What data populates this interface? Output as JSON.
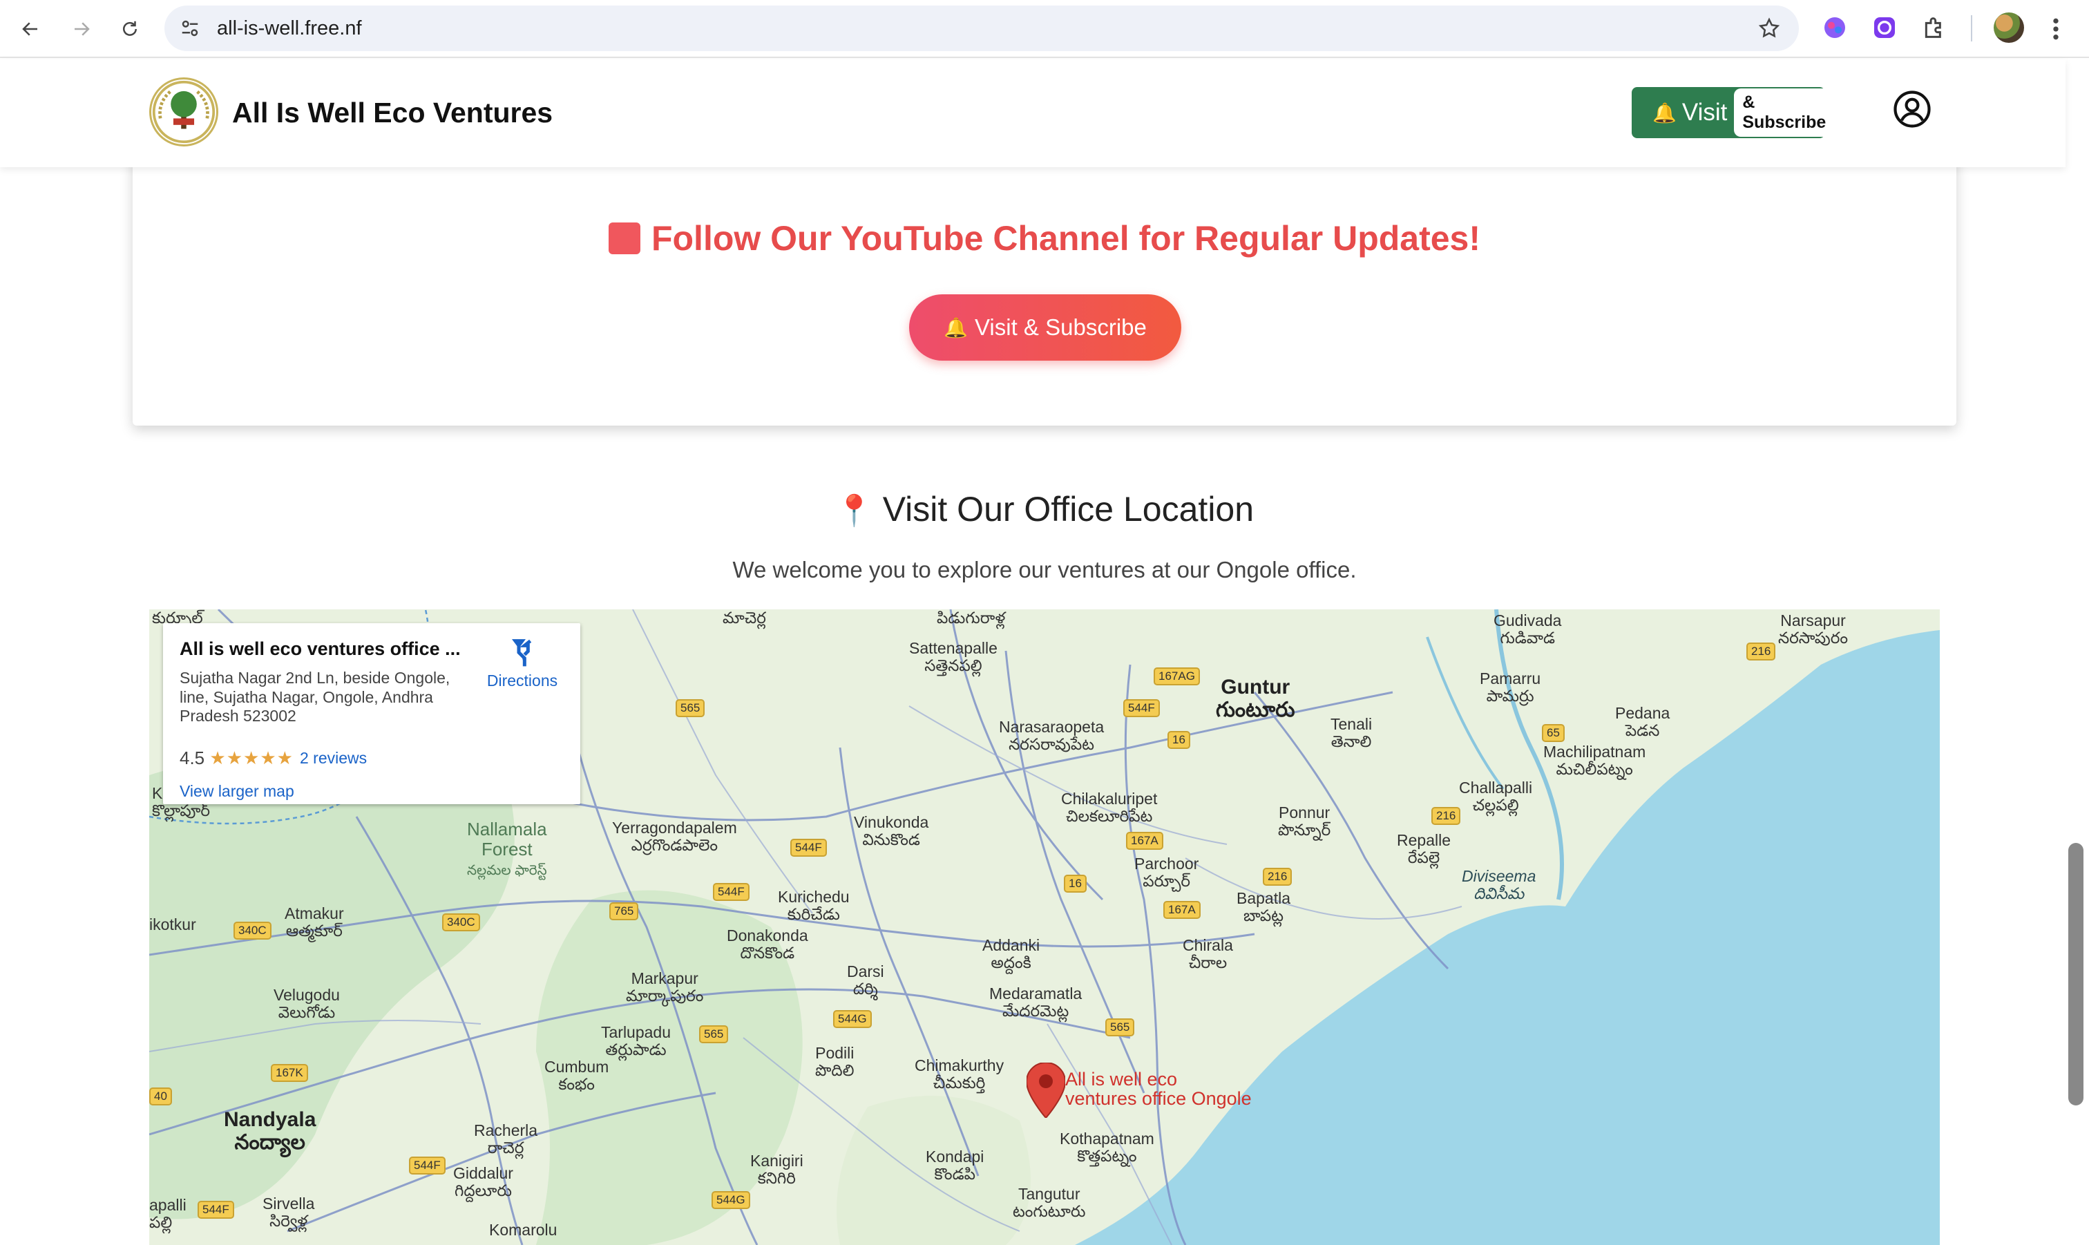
{
  "browser": {
    "url": "all-is-well.free.nf",
    "icons": [
      "back-icon",
      "forward-icon",
      "reload-icon",
      "site-info-icon",
      "bookmark-star-icon",
      "extension-brain-icon",
      "extension-purple-icon",
      "extensions-puzzle-icon",
      "profile-avatar",
      "menu-kebab-icon"
    ]
  },
  "header": {
    "brand": "All Is Well Eco Ventures",
    "visit_label": "Visit",
    "subscribe_pill": "& Subscribe",
    "accent": "#2e7d4f"
  },
  "youtube": {
    "title": "Follow Our YouTube Channel for Regular Updates!",
    "button": "Visit & Subscribe",
    "title_color": "#e74c4c"
  },
  "location": {
    "title": "Visit Our Office Location",
    "subtitle": "We welcome you to explore our ventures at our Ongole office."
  },
  "map": {
    "card": {
      "name": "All is well eco ventures office ...",
      "address": "Sujatha Nagar 2nd Ln, beside Ongole, line, Sujatha Nagar, Ongole, Andhra Pradesh 523002",
      "rating": "4.5",
      "stars": "★★★★★",
      "reviews": "2 reviews",
      "directions": "Directions",
      "larger_map": "View larger map"
    },
    "pin_label_1": "All is well eco",
    "pin_label_2": "ventures office Ongole",
    "places": {
      "guntur": "Guntur",
      "guntur_te": "గుంటూరు",
      "nandyala": "Nandyala",
      "nandyala_te": "నంద్యాల",
      "sattenapalle": "Sattenapalle",
      "sattenapalle_te": "సత్తెనపల్లి",
      "narasaraopeta": "Narasaraopeta",
      "narasaraopeta_te": "నరసరావుపేట",
      "chilakaluripet": "Chilakaluripet",
      "chilakaluripet_te": "చిలకలూరిపేట",
      "vinukonda": "Vinukonda",
      "vinukonda_te": "వినుకొండ",
      "yerragondapalem": "Yerragondapalem",
      "yerragondapalem_te": "ఎర్రగొండపాలెం",
      "nallamala": "Nallamala",
      "forest": "Forest",
      "nallamala_te": "నల్లమల ఫారెస్ట్",
      "atmakur": "Atmakur",
      "atmakur_te": "ఆత్మకూర్",
      "velugodu": "Velugodu",
      "velugodu_te": "వెలుగోడు",
      "kurichedu": "Kurichedu",
      "kurichedu_te": "కురిచేడు",
      "donakonda": "Donakonda",
      "donakonda_te": "దొనకొండ",
      "markapur": "Markapur",
      "markapur_te": "మార్కాపురం",
      "tarlupadu": "Tarlupadu",
      "tarlupadu_te": "తర్లుపాడు",
      "cumbum": "Cumbum",
      "cumbum_te": "కంభం",
      "racherla": "Racherla",
      "racherla_te": "రాచెర్ల",
      "giddalur": "Giddalur",
      "giddalur_te": "గిద్దలూరు",
      "sirvella": "Sirvella",
      "sirvella_te": "సిర్వెళ్ల",
      "komarolu": "Komarolu",
      "kanigiri": "Kanigiri",
      "kanigiri_te": "కనిగిరి",
      "kondapi": "Kondapi",
      "kondapi_te": "కొండపి",
      "tangutur": "Tangutur",
      "tangutur_te": "టంగుటూరు",
      "podili": "Podili",
      "podili_te": "పొదిలి",
      "darsi": "Darsi",
      "darsi_te": "దర్శి",
      "chimakurthy": "Chimakurthy",
      "chimakurthy_te": "చీమకుర్తి",
      "addanki": "Addanki",
      "addanki_te": "అద్దంకి",
      "medaramatla": "Medaramatla",
      "medaramatla_te": "మేదరమెట్ల",
      "kothapatnam": "Kothapatnam",
      "kothapatnam_te": "కొత్తపట్నం",
      "parchoor": "Parchoor",
      "parchoor_te": "పర్చూర్",
      "bapatla": "Bapatla",
      "bapatla_te": "బాపట్ల",
      "chirala": "Chirala",
      "chirala_te": "చీరాల",
      "ponnur": "Ponnur",
      "ponnur_te": "పొన్నూర్",
      "tenali": "Tenali",
      "tenali_te": "తెనాలి",
      "repalle": "Repalle",
      "repalle_te": "రేపల్లె",
      "challapalli": "Challapalli",
      "challapalli_te": "చల్లపల్లి",
      "pamarru": "Pamarru",
      "pamarru_te": "పామర్రు",
      "pedana": "Pedana",
      "pedana_te": "పెడన",
      "machilipatnam": "Machilipatnam",
      "machilipatnam_te": "మచిలీపట్నం",
      "gudivada": "Gudivada",
      "gudivada_te": "గుడివాడ",
      "narsapur": "Narsapur",
      "narsapur_te": "నరసాపురం",
      "diviseema": "Diviseema",
      "diviseema_te": "దివిసీమ",
      "ikotkur": "ikotkur",
      "apalli": "apalli",
      "apalli_te": "పల్లి",
      "k_label": "K",
      "top1": "మాచెర్ల",
      "top2": "పిడుగురాళ్ల",
      "top3": "కుర్నూల్",
      "kollapur_te": "కొల్లాపూర్"
    },
    "shields": [
      "565",
      "167AG",
      "544F",
      "16",
      "65",
      "216",
      "544F",
      "167A",
      "16",
      "544F",
      "765",
      "340C",
      "340C",
      "167A",
      "216",
      "216",
      "544G",
      "565",
      "167K",
      "544F",
      "544F",
      "544G",
      "40",
      "565"
    ]
  }
}
